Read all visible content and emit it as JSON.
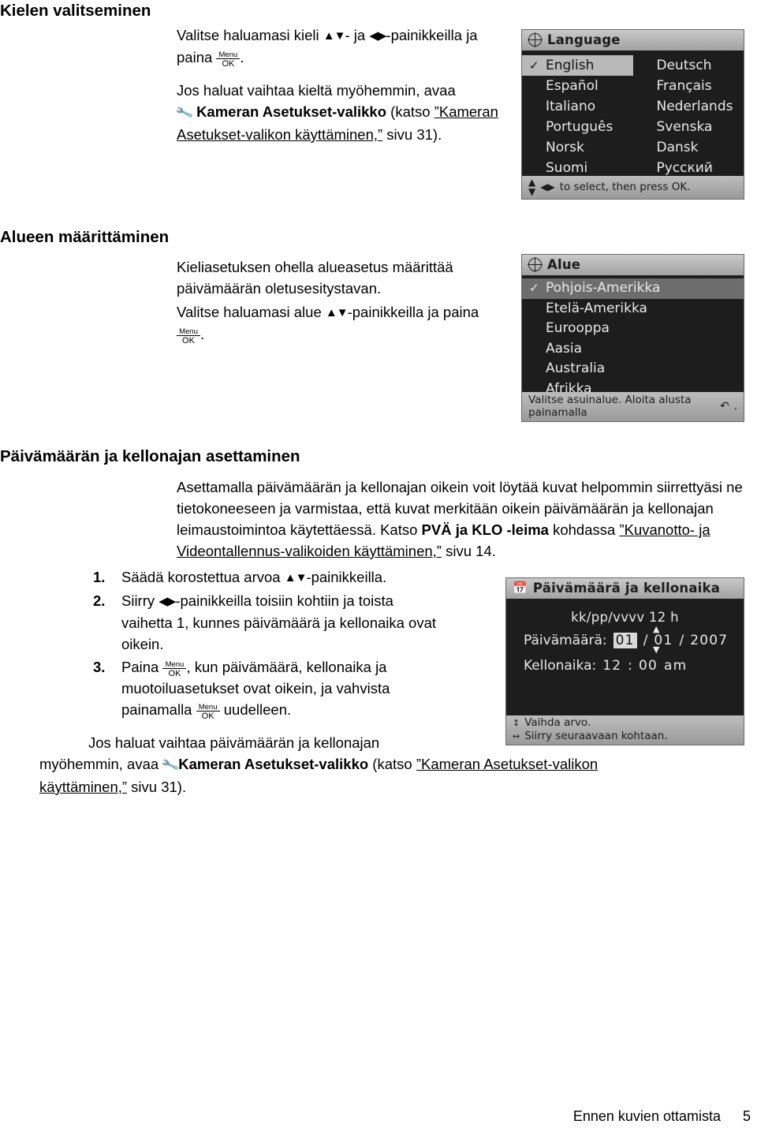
{
  "doc": {
    "heading1": "Kielen valitseminen",
    "p1_a": "Valitse haluamasi kieli ",
    "p1_b": "- ja ",
    "p1_c": "-painikkeilla ja",
    "p1_d": "paina",
    "p2_a": "Jos haluat vaihtaa kieltä myöhemmin, avaa",
    "p2_b": "Kameran Asetukset-valikko",
    "p2_c": " (katso ",
    "p2_link1": "”Kameran",
    "p2_link2": "Asetukset-valikon käyttäminen,”",
    "p2_d": " sivu 31).",
    "heading2": "Alueen määrittäminen",
    "p3_l1": "Kieliasetuksen ohella alueasetus määrittää",
    "p3_l2": "päivämäärän oletusesitystavan.",
    "p4_a": "Valitse haluamasi alue ",
    "p4_b": "-painikkeilla ja paina",
    "heading3": "Päivämäärän ja kellonajan asettaminen",
    "p5_l1": "Asettamalla päivämäärän ja kellonajan oikein voit löytää kuvat helpommin siirrettyäsi ne",
    "p5_l2": "tietokoneeseen ja varmistaa, että kuvat merkitään oikein päivämäärän ja kellonajan",
    "p5_l3_a": "leimaustoimintoa käytettäessä. Katso ",
    "p5_l3_bold": "PVÄ ja KLO -leima",
    "p5_l3_b": " kohdassa ",
    "p5_link1": "”Kuvanotto- ja",
    "p5_link2": "Videontallennus-valikoiden käyttäminen,”",
    "p5_l4_b": " sivu 14.",
    "step1_num": "1.",
    "step1_a": "Säädä korostettua arvoa ",
    "step1_b": "-painikkeilla.",
    "step2_num": "2.",
    "step2_a": "Siirry ",
    "step2_b": "-painikkeilla toisiin kohtiin ja toista",
    "step2_l2": "vaihetta 1, kunnes päivämäärä ja kellonaika ovat",
    "step2_l3": "oikein.",
    "step3_num": "3.",
    "step3_a": "Paina ",
    "step3_b": ", kun päivämäärä, kellonaika ja",
    "step3_l2": "muotoiluasetukset ovat oikein, ja vahvista",
    "step3_l3_a": "painamalla ",
    "step3_l3_b": " uudelleen.",
    "p6_l1": "Jos haluat vaihtaa päivämäärän ja kellonajan",
    "p6_l2_a": "myöhemmin, avaa ",
    "p6_l2_bold": "Kameran Asetukset-valikko",
    "p6_l2_b": " (katso ",
    "p6_link1": "”Kameran Asetukset-valikon",
    "p6_link2": "käyttäminen,”",
    "p6_l3_b": " sivu 31).",
    "footer_text": "Ennen kuvien ottamista",
    "footer_page": "5",
    "ok_menu": "Menu",
    "ok_ok": "OK"
  },
  "lcd_language": {
    "title": "Language",
    "items": [
      [
        "English",
        "Deutsch"
      ],
      [
        "Español",
        "Français"
      ],
      [
        "Italiano",
        "Nederlands"
      ],
      [
        "Português",
        "Svenska"
      ],
      [
        "Norsk",
        "Dansk"
      ],
      [
        "Suomi",
        "Русский"
      ]
    ],
    "selected": "English",
    "footer": "to select, then press OK."
  },
  "lcd_region": {
    "title": "Alue",
    "items": [
      "Pohjois-Amerikka",
      "Etelä-Amerikka",
      "Eurooppa",
      "Aasia",
      "Australia",
      "Afrikka"
    ],
    "selected": "Pohjois-Amerikka",
    "footer": "Valitse asuinalue. Aloita alusta painamalla"
  },
  "lcd_datetime": {
    "title": "Päivämäärä ja kellonaika",
    "format": "kk/pp/vvvv 12 h",
    "date_label": "Päivämäärä:",
    "date_month": "01",
    "date_sep1": "/",
    "date_day": "01",
    "date_sep2": "/",
    "date_year": "2007",
    "time_label": "Kellonaika:",
    "time_hour": "12",
    "time_sep": ":",
    "time_min": "00",
    "time_ampm": "am",
    "footer_line1": "Vaihda arvo.",
    "footer_line2": "Siirry seuraavaan kohtaan."
  }
}
